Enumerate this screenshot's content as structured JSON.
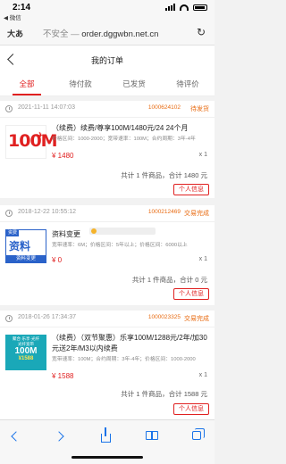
{
  "status_bar": {
    "time": "2:14",
    "back_app": "◀ 微信"
  },
  "url_bar": {
    "translate": "大あ",
    "insecure": "不安全 — ",
    "host": "order.dggwbn.net.cn"
  },
  "header": {
    "title": "我的订单"
  },
  "tabs": [
    {
      "label": "全部",
      "active": true
    },
    {
      "label": "待付款",
      "active": false
    },
    {
      "label": "已发货",
      "active": false
    },
    {
      "label": "待评价",
      "active": false
    }
  ],
  "orders": [
    {
      "date": "2021-11-11 14:07:03",
      "order_no": "1000624102",
      "status": "待发货",
      "thumb": {
        "big": "100M",
        "plane": "✈"
      },
      "title": "（续费）续费/尊享100M/1480元/24 24个月",
      "spec": "价格区间：1000-2000；宽带速率：100M；合约周期：3年-4年",
      "price": "¥ 1480",
      "qty": "x 1",
      "total": "共计 1 件商品，合计 1480 元",
      "button": "个人信息"
    },
    {
      "date": "2018-12-22 10:55:12",
      "order_no": "1000212469",
      "status": "交易完成",
      "thumb": {
        "tag": "资费",
        "big": "资料",
        "sub": "资料变更"
      },
      "title": "资料变更",
      "spec": "宽带速率：6M；价格区间：5年以上；价格区间：6000以上",
      "price": "¥ 0",
      "qty": "x 1",
      "total": "共计 1 件商品，合计 0 元",
      "button": "个人信息"
    },
    {
      "date": "2018-01-26 17:34:37",
      "order_no": "1000023325",
      "status": "交易完成",
      "thumb": {
        "t1": "聚合·乐享·光纤",
        "t2": "光纤宽带",
        "t3": "100M",
        "t4": "¥1588"
      },
      "title": "（续费）（双节聚惠）乐享100M/1288元/2年/加30元送2年/M3以内续费",
      "spec": "宽带速率：100M；合约周期：3年-4年；价格区间：1000-2000",
      "price": "¥ 1588",
      "qty": "x 1",
      "total": "共计 1 件商品，合计 1588 元",
      "button": "个人信息"
    }
  ],
  "colors": {
    "accent": "#e02020",
    "orange": "#e86b12",
    "link": "#1a73e8"
  }
}
